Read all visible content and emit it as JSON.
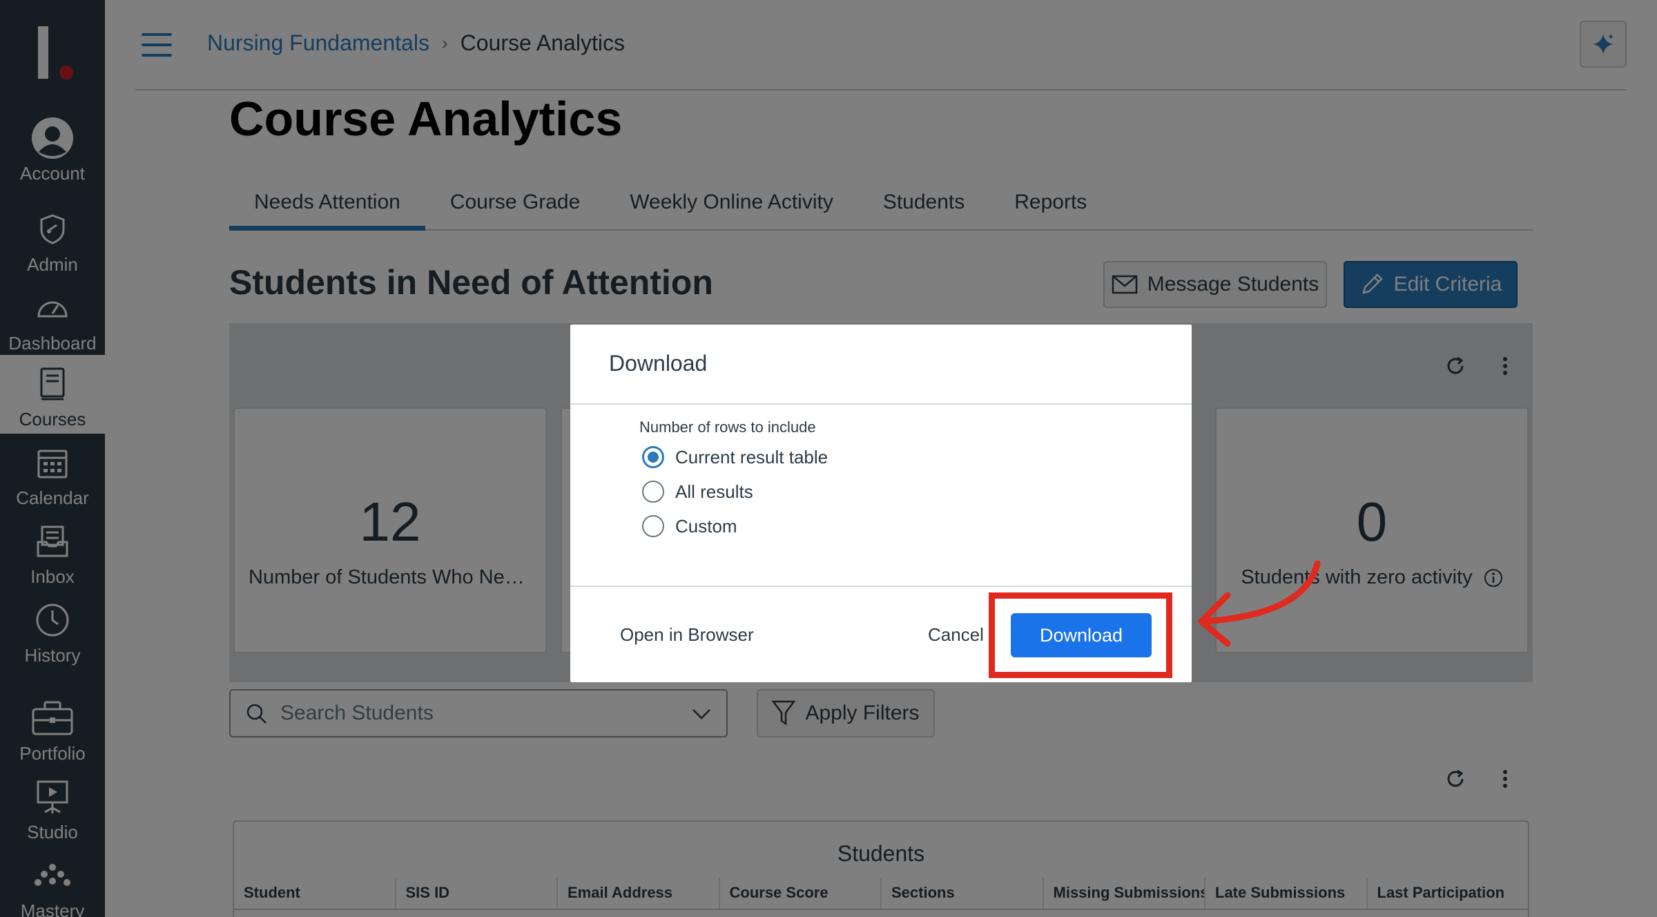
{
  "global_nav": {
    "items": [
      {
        "label": "Account",
        "icon": "account-icon"
      },
      {
        "label": "Admin",
        "icon": "admin-shield-icon"
      },
      {
        "label": "Dashboard",
        "icon": "dashboard-gauge-icon"
      },
      {
        "label": "Courses",
        "icon": "courses-book-icon",
        "active": true
      },
      {
        "label": "Calendar",
        "icon": "calendar-icon"
      },
      {
        "label": "Inbox",
        "icon": "inbox-icon"
      },
      {
        "label": "History",
        "icon": "history-clock-icon"
      },
      {
        "label": "Portfolio",
        "icon": "portfolio-briefcase-icon"
      },
      {
        "label": "Studio",
        "icon": "studio-icon"
      },
      {
        "label": "Mastery",
        "icon": "mastery-icon"
      }
    ]
  },
  "breadcrumb": {
    "course": "Nursing Fundamentals",
    "separator": "›",
    "current": "Course Analytics"
  },
  "page": {
    "title": "Course Analytics"
  },
  "tabs": [
    {
      "label": "Needs Attention",
      "active": true
    },
    {
      "label": "Course Grade"
    },
    {
      "label": "Weekly Online Activity"
    },
    {
      "label": "Students"
    },
    {
      "label": "Reports"
    }
  ],
  "section": {
    "title": "Students in Need of Attention",
    "message_button": "Message Students",
    "edit_button": "Edit Criteria"
  },
  "cards": [
    {
      "value": "12",
      "label": "Number of Students Who Nee..."
    },
    {
      "value": "0",
      "label": "Students with zero activity"
    }
  ],
  "search": {
    "placeholder": "Search Students"
  },
  "filters": {
    "apply_label": "Apply Filters"
  },
  "table": {
    "title": "Students",
    "columns": [
      "Student",
      "SIS ID",
      "Email Address",
      "Course Score",
      "Sections",
      "Missing Submissions",
      "Late Submissions",
      "Last Participation"
    ]
  },
  "modal": {
    "title": "Download",
    "legend": "Number of rows to include",
    "options": [
      {
        "label": "Current result table",
        "checked": true
      },
      {
        "label": "All results",
        "checked": false
      },
      {
        "label": "Custom",
        "checked": false
      }
    ],
    "open_in_browser": "Open in Browser",
    "cancel": "Cancel",
    "download": "Download"
  },
  "colors": {
    "nav_bg": "#2d3b45",
    "brand_blue": "#2b7abc",
    "primary_button": "#1a73e8",
    "annotation_red": "#e0291f"
  }
}
